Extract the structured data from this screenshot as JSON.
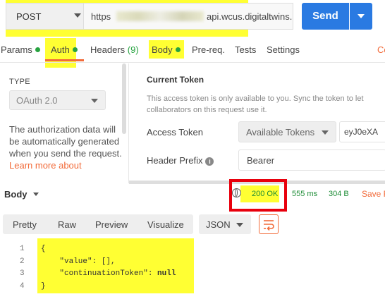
{
  "request": {
    "method": "POST",
    "url_start": "https",
    "url_end": "api.wcus.digitaltwins.a",
    "send_label": "Send"
  },
  "tabs": [
    {
      "label": "Params",
      "dot": true
    },
    {
      "label": "Auth",
      "dot": true,
      "active": true
    },
    {
      "label": "Headers",
      "count": "(9)"
    },
    {
      "label": "Body",
      "dot": true
    },
    {
      "label": "Pre-req."
    },
    {
      "label": "Tests"
    },
    {
      "label": "Settings"
    }
  ],
  "cookies_label": "Co",
  "auth": {
    "type_label": "TYPE",
    "type_value": "OAuth 2.0",
    "description": "The authorization data will be automatically generated when you send the request.",
    "learn_more": "Learn more about"
  },
  "token": {
    "heading": "Current Token",
    "description": "This access token is only available to you. Sync the token to let collaborators on this request use it.",
    "access_label": "Access Token",
    "access_select": "Available Tokens",
    "access_value": "eyJ0eXA",
    "prefix_label": "Header Prefix",
    "prefix_value": "Bearer"
  },
  "response": {
    "body_label": "Body",
    "status": "200 OK",
    "time": "555 ms",
    "size": "304 B",
    "save": "Save R",
    "views": [
      "Pretty",
      "Raw",
      "Preview",
      "Visualize"
    ],
    "format": "JSON"
  },
  "code": {
    "line_numbers": [
      "1",
      "2",
      "3",
      "4"
    ],
    "lines": [
      "{",
      "    \"value\": [],",
      "    \"continuationToken\": ",
      "}"
    ],
    "null_literal": "null"
  },
  "colors": {
    "accent": "#f26b3a",
    "send": "#2a7ae2",
    "status_ok": "#1c8c35",
    "highlight": "#ffff33",
    "annotation_box": "#e8000d"
  }
}
